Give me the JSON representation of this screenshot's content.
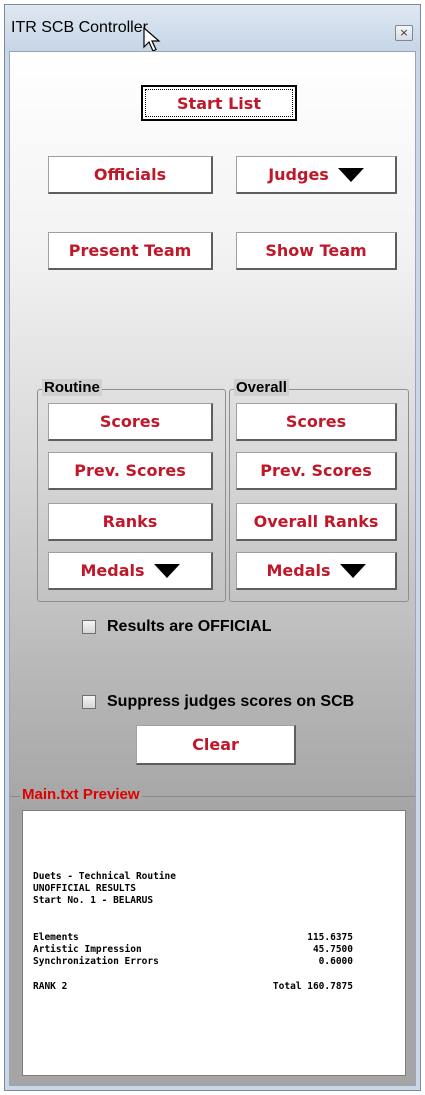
{
  "window": {
    "title": "ITR SCB Controller",
    "close_glyph": "×"
  },
  "buttons": {
    "start_list": "Start List",
    "officials": "Officials",
    "judges": "Judges",
    "present_team": "Present Team",
    "show_team": "Show Team"
  },
  "routine": {
    "label": "Routine",
    "scores": "Scores",
    "prev_scores": "Prev. Scores",
    "ranks": "Ranks",
    "medals": "Medals"
  },
  "overall": {
    "label": "Overall",
    "scores": "Scores",
    "prev_scores": "Prev. Scores",
    "ranks": "Overall Ranks",
    "medals": "Medals"
  },
  "options": {
    "results_official": "Results are OFFICIAL",
    "results_official_checked": false,
    "suppress_judges": "Suppress judges scores on SCB",
    "suppress_judges_checked": false
  },
  "clear_label": "Clear",
  "preview": {
    "label": "Main.txt Preview",
    "header": [
      "Duets - Technical Routine",
      "UNOFFICIAL RESULTS",
      "Start No. 1 - BELARUS"
    ],
    "scores": [
      {
        "label": "Elements",
        "value": "115.6375"
      },
      {
        "label": "Artistic Impression",
        "value": "45.7500"
      },
      {
        "label": "Synchronization Errors",
        "value": "0.6000"
      }
    ],
    "rank": "RANK 2",
    "total": "Total 160.7875"
  },
  "colors": {
    "button_text": "#c0182a",
    "preview_label": "#e00000"
  }
}
